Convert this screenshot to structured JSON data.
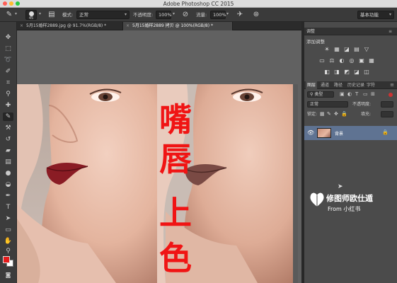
{
  "app": {
    "title": "Adobe Photoshop CC 2015"
  },
  "options_bar": {
    "brush_size": "45",
    "mode_label": "模式:",
    "mode_value": "正常",
    "opacity_label": "不透明度:",
    "opacity_value": "100%",
    "flow_label": "流量:",
    "flow_value": "100%",
    "workspace": "基本功能"
  },
  "document_tabs": [
    {
      "label": "5月15婚样2889.jpg @ 91.7%(RGB/8) *"
    },
    {
      "label": "5月15婚样2889 拷贝 @ 100%(RGB/8) *"
    }
  ],
  "overlay_text": [
    "嘴",
    "唇",
    "上",
    "色"
  ],
  "panels": {
    "color_tab": "调整",
    "adjustments_title": "添加调整",
    "adjust_icons_row1": [
      "☀",
      "▦",
      "◪",
      "▤",
      "▽"
    ],
    "adjust_icons_row2": [
      "▭",
      "⚖",
      "◐",
      "◎",
      "▣",
      "▦"
    ],
    "adjust_icons_row3": [
      "◧",
      "◨",
      "◩",
      "◪",
      "◫"
    ],
    "layers_tabs": [
      "图层",
      "通道",
      "路径",
      "历史记录",
      "字符"
    ],
    "filter_label": "类型",
    "blend_mode": "正常",
    "opacity_label": "不透明度:",
    "lock_label": "锁定:",
    "fill_label": "填充:",
    "layer_name": "背景"
  },
  "watermark": {
    "main": "修图师欧仕遁",
    "sub": "From 小红书"
  },
  "colors": {
    "foreground": "#e51b1b",
    "background": "#ffffff",
    "overlay_text": "#f01414",
    "selected_layer": "#5f7392"
  }
}
